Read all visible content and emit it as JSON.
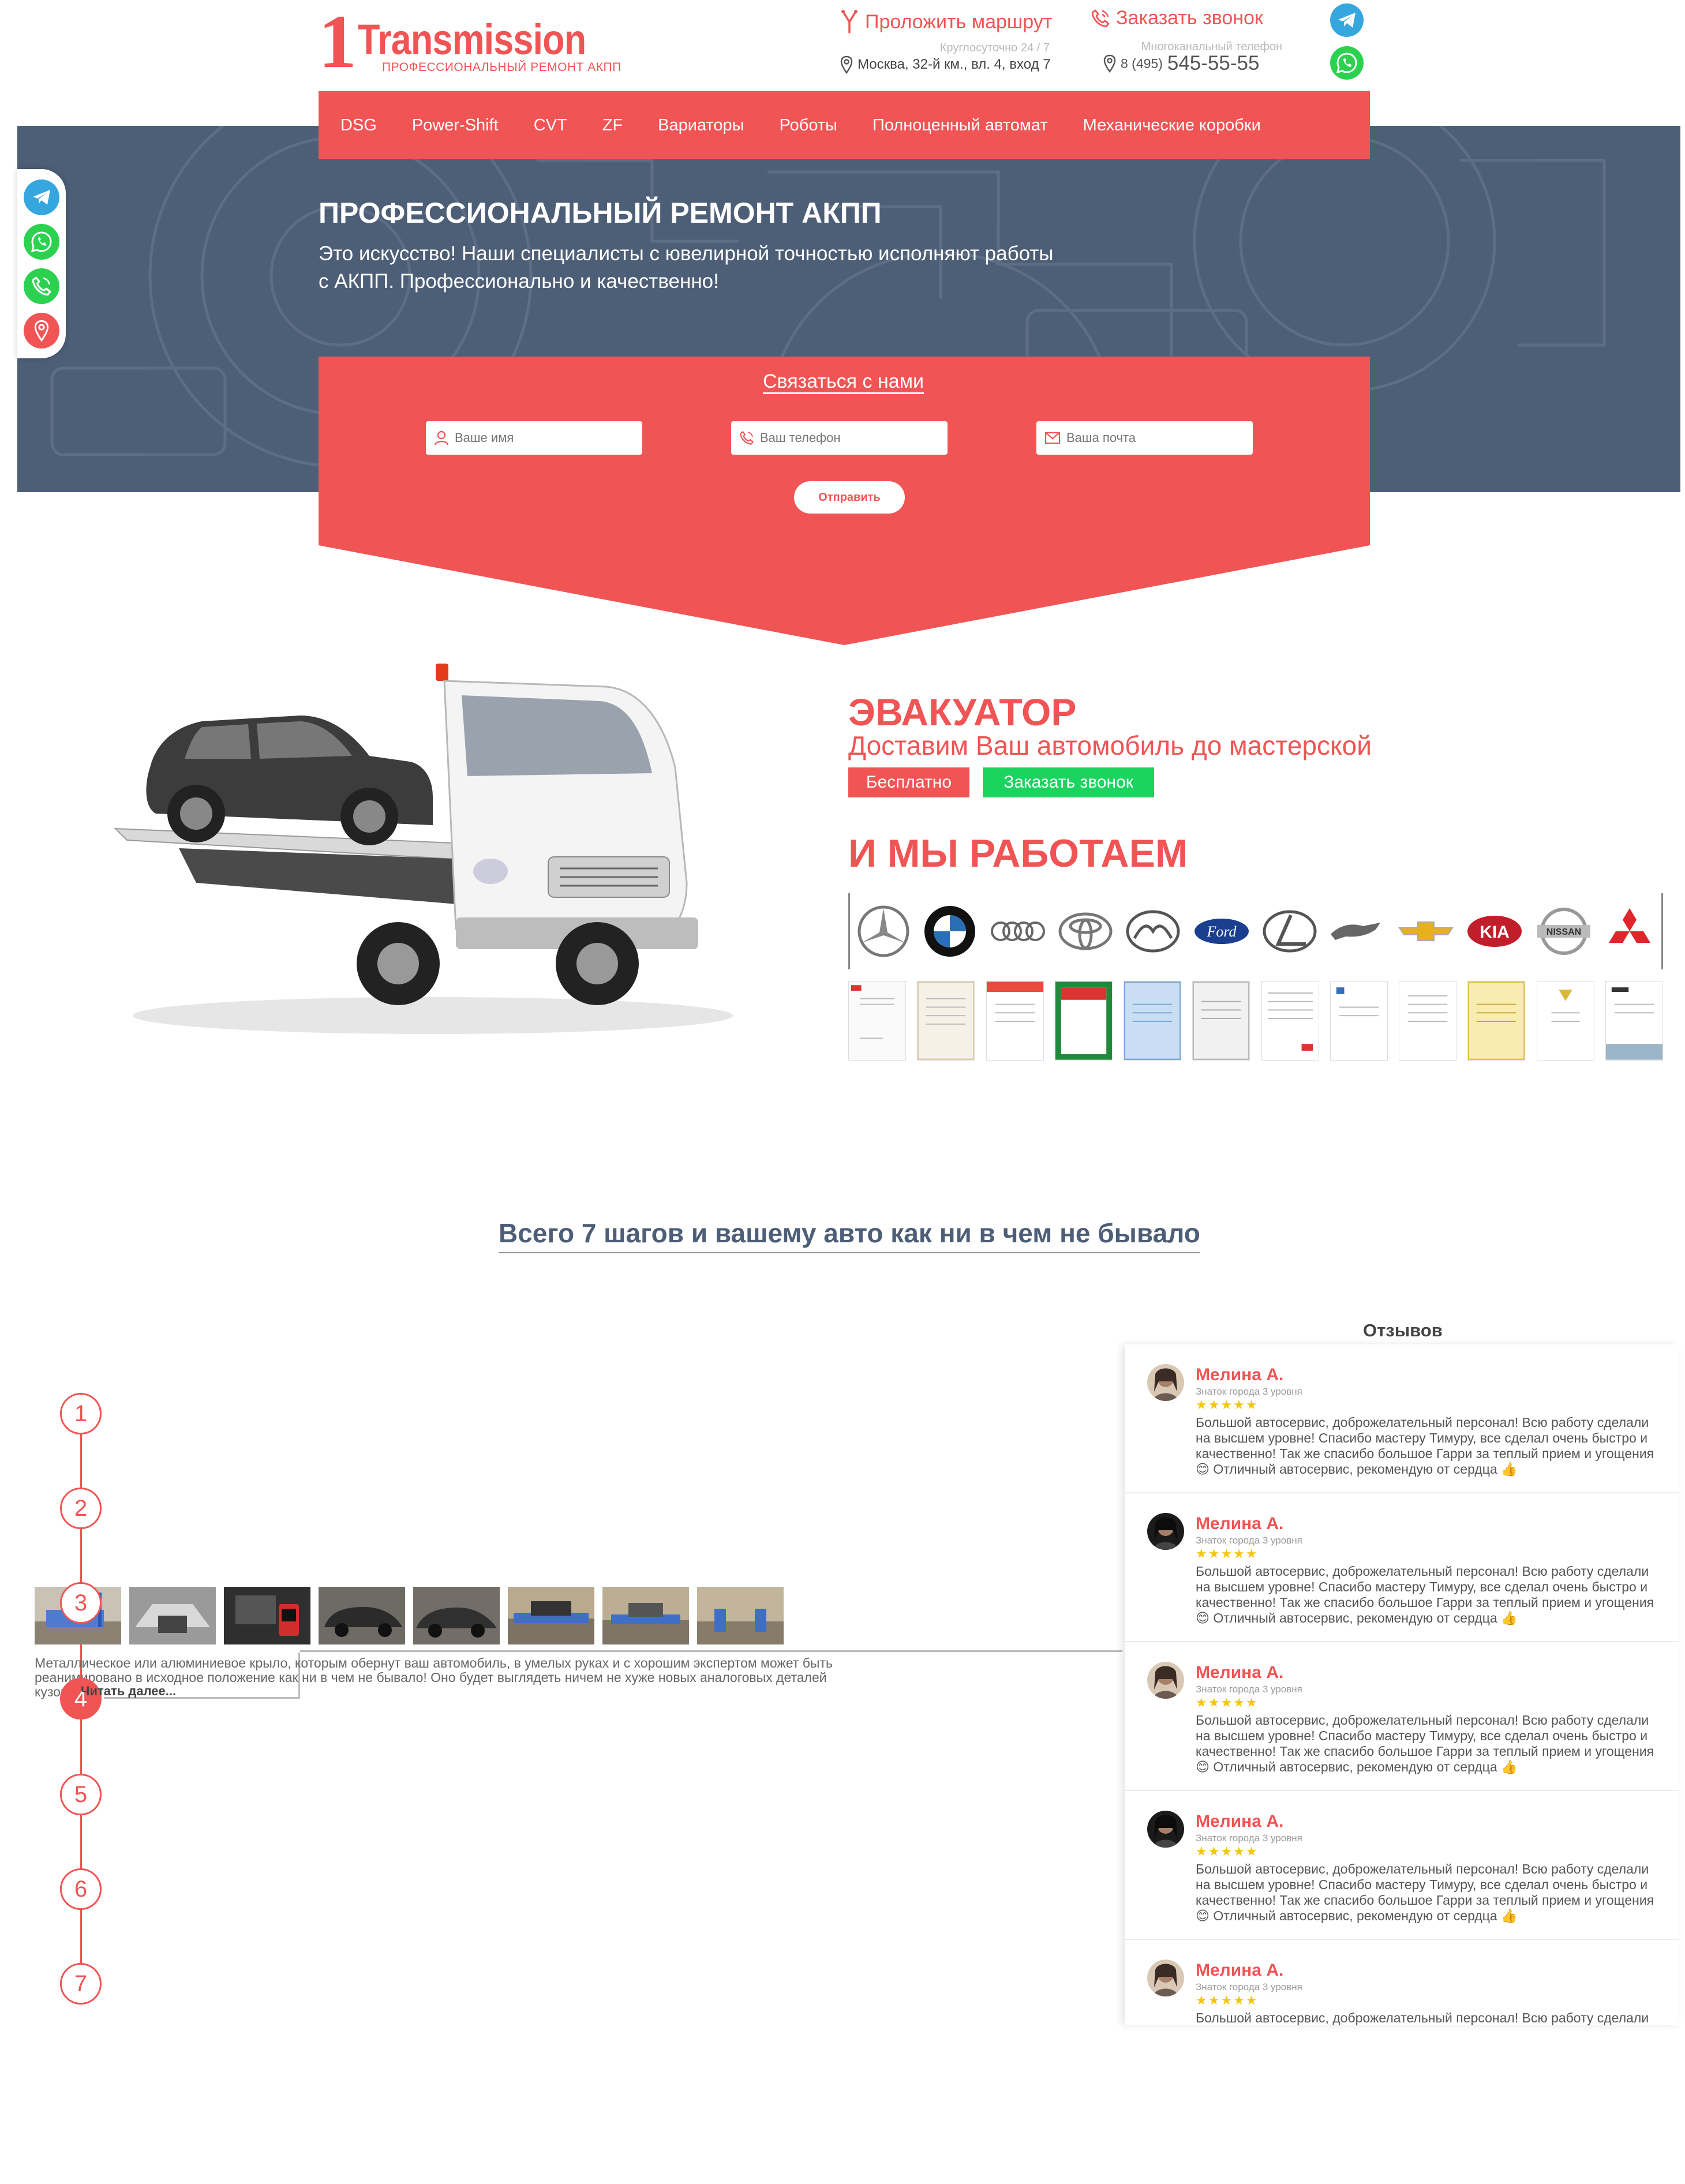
{
  "header": {
    "logo_number": "1",
    "logo_word": "Transmission",
    "logo_tagline": "ПРОФЕССИОНАЛЬНЫЙ РЕМОНТ АКПП",
    "route_label": "Проложить маршрут",
    "hours": "Круглосуточно 24 / 7",
    "address": "Москва, 32-й км., вл. 4, вход 7",
    "call_label": "Заказать звонок",
    "phone_note": "Многоканальный телефон",
    "phone_code": "8 (495)",
    "phone_number": "545-55-55"
  },
  "nav": {
    "items": [
      "DSG",
      "Power-Shift",
      "CVT",
      "ZF",
      "Вариаторы",
      "Роботы",
      "Полноценный автомат",
      "Механические коробки"
    ]
  },
  "hero": {
    "title": "ПРОФЕССИОНАЛЬНЫЙ РЕМОНТ АКПП",
    "subtitle": "Это искусство! Наши специалисты с ювелирной точностью исполняют работы с АКПП. Профессионально и качественно!"
  },
  "form": {
    "title": "Связаться с нами",
    "name_placeholder": "Ваше имя",
    "phone_placeholder": "Ваш телефон",
    "email_placeholder": "Ваша почта",
    "submit_label": "Отправить"
  },
  "evacuator": {
    "title": "ЭВАКУАТОР",
    "subtitle": "Доставим Ваш автомобиль до мастерской",
    "free_label": "Бесплатно",
    "call_label": "Заказать звонок",
    "work_title": "И МЫ РАБОТАЕМ"
  },
  "brands": [
    "mercedes-logo",
    "bmw-logo",
    "audi-logo",
    "toyota-logo",
    "mazda-logo",
    "ford-logo",
    "lexus-logo",
    "jaguar-logo",
    "chevrolet-logo",
    "kia-logo",
    "nissan-logo",
    "mitsubishi-logo"
  ],
  "steps": {
    "title": "Всего 7 шагов и вашему авто как ни в чем не бывало",
    "numbers": [
      "1",
      "2",
      "3",
      "4",
      "5",
      "6",
      "7"
    ],
    "active": 4,
    "description": "Металлическое или алюминиевое крыло, которым обернут ваш автомобиль, в умелых руках и с хорошим экспертом может быть реанимировано в исходное положение как ни в чем не бывало! Оно будет выглядеть ничем не хуже новых аналоговых деталей кузова.",
    "read_more": "Читать далее..."
  },
  "reviews": {
    "title": "Отзывов",
    "items": [
      {
        "name": "Мелина А.",
        "level": "Знаток города 3 уровня",
        "stars": "★★★★★",
        "text": "Большой автосервис, доброжелательный персонал! Всю работу сделали на высшем уровне! Спасибо мастеру Тимуру, все сделал очень быстро и качественно! Так же спасибо большое Гарри за теплый прием и угощения 😊 Отличный автосервис, рекомендую от сердца 👍"
      },
      {
        "name": "Мелина А.",
        "level": "Знаток города 3 уровня",
        "stars": "★★★★★",
        "text": "Большой автосервис, доброжелательный персонал! Всю работу сделали на высшем уровне! Спасибо мастеру Тимуру, все сделал очень быстро и качественно! Так же спасибо большое Гарри за теплый прием и угощения 😊 Отличный автосервис, рекомендую от сердца 👍"
      },
      {
        "name": "Мелина А.",
        "level": "Знаток города 3 уровня",
        "stars": "★★★★★",
        "text": "Большой автосервис, доброжелательный персонал! Всю работу сделали на высшем уровне! Спасибо мастеру Тимуру, все сделал очень быстро и качественно! Так же спасибо большое Гарри за теплый прием и угощения 😊 Отличный автосервис, рекомендую от сердца 👍"
      },
      {
        "name": "Мелина А.",
        "level": "Знаток города 3 уровня",
        "stars": "★★★★★",
        "text": "Большой автосервис, доброжелательный персонал! Всю работу сделали на высшем уровне! Спасибо мастеру Тимуру, все сделал очень быстро и качественно! Так же спасибо большое Гарри за теплый прием и угощения 😊 Отличный автосервис, рекомендую от сердца 👍"
      },
      {
        "name": "Мелина А.",
        "level": "Знаток города 3 уровня",
        "stars": "★★★★★",
        "text": "Большой автосервис, доброжелательный персонал! Всю работу сделали на высшем уровне! Спасибо мастеру Тимуру, все сделал очень быстро и качественно! Так же спасибо большое Гарри за теплый прием и угощения 😊 Отличный автосервис, рекомендую от сердца 👍"
      }
    ]
  },
  "colors": {
    "accent": "#f05454",
    "hero_bg": "#4d5e77",
    "green": "#1bd35f",
    "telegram": "#35a6de",
    "whatsapp": "#2bd14f",
    "star": "#f3c60c"
  },
  "icons": {
    "route": "route-icon",
    "phone": "phone-icon",
    "pin": "pin-icon",
    "telegram": "telegram-icon",
    "whatsapp": "whatsapp-icon",
    "user": "user-icon",
    "mail": "mail-icon"
  }
}
